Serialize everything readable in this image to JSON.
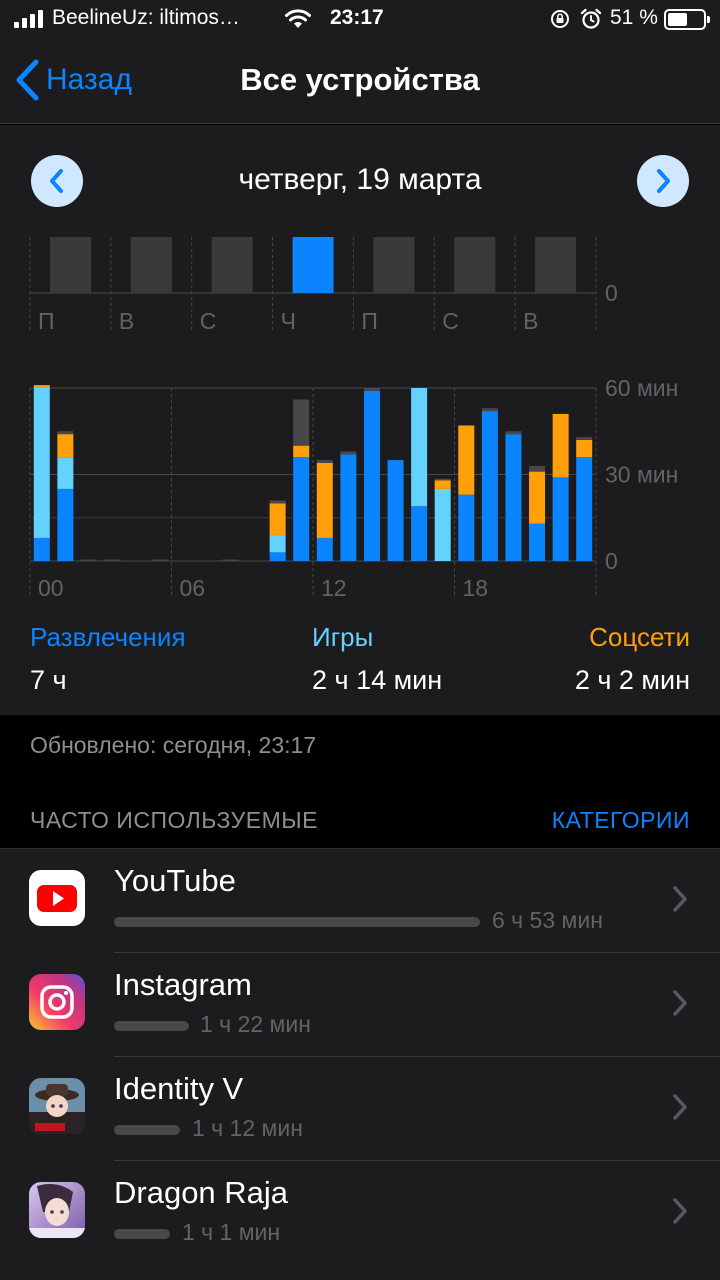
{
  "status_bar": {
    "carrier": "BeelineUz: iltimos…",
    "time": "23:17",
    "battery_percent": "51 %",
    "battery_level": 0.51
  },
  "nav": {
    "back_label": "Назад",
    "title": "Все устройства"
  },
  "date_bar": {
    "label": "четверг, 19 марта"
  },
  "weekly_chart": {
    "days": [
      "П",
      "В",
      "С",
      "Ч",
      "П",
      "С",
      "В"
    ],
    "selected_index": 3,
    "axis_zero": "0"
  },
  "chart_data": {
    "type": "bar",
    "stacked": true,
    "x_tick_labels": [
      "00",
      "06",
      "12",
      "18"
    ],
    "y_tick_labels": [
      "60 мин",
      "30 мин",
      "0"
    ],
    "ylim": [
      0,
      60
    ],
    "categories": [
      "00",
      "01",
      "02",
      "03",
      "04",
      "05",
      "06",
      "07",
      "08",
      "09",
      "10",
      "11",
      "12",
      "13",
      "14",
      "15",
      "16",
      "17",
      "18",
      "19",
      "20",
      "21",
      "22",
      "23"
    ],
    "series": [
      {
        "name": "Развлечения",
        "color": "#0a84ff",
        "values": [
          8,
          25,
          0,
          0,
          0,
          0,
          0,
          0,
          0,
          0,
          3,
          36,
          8,
          37,
          59,
          35,
          19,
          0,
          23,
          52,
          44,
          13,
          29,
          36
        ]
      },
      {
        "name": "Игры",
        "color": "#64d2ff",
        "values": [
          52,
          11,
          0,
          0,
          0,
          0,
          0,
          0,
          0,
          0,
          6,
          0,
          0,
          0,
          0,
          0,
          41,
          25,
          0,
          0,
          0,
          0,
          0,
          0
        ]
      },
      {
        "name": "Соцсети",
        "color": "#ff9f0a",
        "values": [
          1,
          8,
          0,
          0,
          0,
          0,
          0,
          0,
          0,
          0,
          11,
          4,
          26,
          0,
          0,
          0,
          0,
          3,
          24,
          0,
          0,
          18,
          22,
          6
        ]
      },
      {
        "name": "",
        "color": "#48484a",
        "values": [
          0,
          1,
          0.5,
          0.5,
          0,
          0.5,
          0,
          0,
          0.5,
          0,
          1,
          16,
          1,
          1,
          1,
          0,
          0,
          0.5,
          0,
          1,
          1,
          2,
          0,
          1
        ]
      }
    ]
  },
  "categories": [
    {
      "name": "Развлечения",
      "value": "7 ч",
      "color": "#0a84ff"
    },
    {
      "name": "Игры",
      "value": "2 ч 14 мин",
      "color": "#64d2ff"
    },
    {
      "name": "Соцсети",
      "value": "2 ч 2 мин",
      "color": "#ff9f0a"
    }
  ],
  "updated": "Обновлено: сегодня, 23:17",
  "most_used": {
    "header": "ЧАСТО ИСПОЛЬЗУЕМЫЕ",
    "link": "КАТЕГОРИИ",
    "apps": [
      {
        "name": "YouTube",
        "time": "6 ч 53 мин",
        "usage_fraction": 1.0,
        "icon": "youtube-icon"
      },
      {
        "name": "Instagram",
        "time": "1 ч 22 мин",
        "usage_fraction": 0.2,
        "icon": "instagram-icon"
      },
      {
        "name": "Identity V",
        "time": "1 ч 12 мин",
        "usage_fraction": 0.17,
        "icon": "identity-v-icon"
      },
      {
        "name": "Dragon Raja",
        "time": "1 ч 1 мин",
        "usage_fraction": 0.15,
        "icon": "dragon-raja-icon"
      }
    ]
  }
}
